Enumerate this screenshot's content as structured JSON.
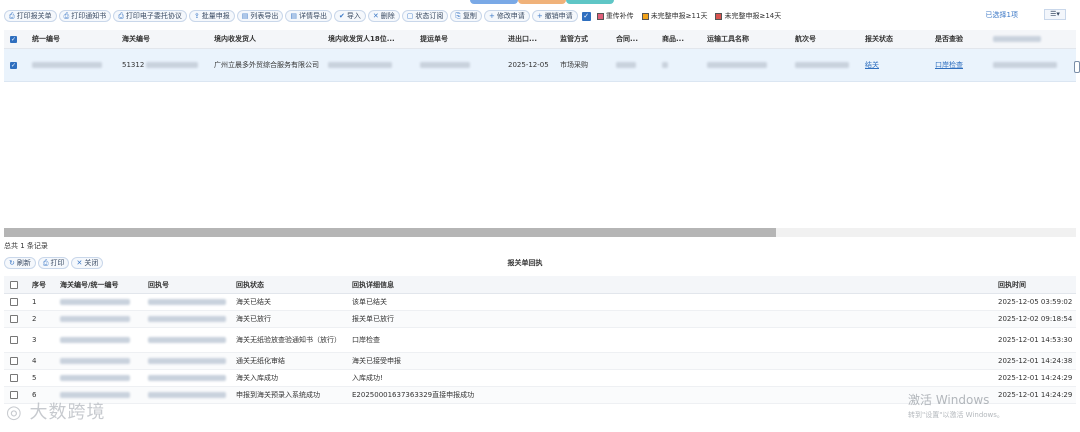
{
  "top_tabs": [
    {
      "color": "#7aa9e6"
    },
    {
      "color": "#f0b27a"
    },
    {
      "color": "#5fc6c6"
    }
  ],
  "toolbar": {
    "buttons": [
      {
        "icon": "print-icon",
        "glyph": "⎙",
        "label": "打印报关单"
      },
      {
        "icon": "print-icon",
        "glyph": "⎙",
        "label": "打印通知书"
      },
      {
        "icon": "print-icon",
        "glyph": "⎙",
        "label": "打印电子委托协议"
      },
      {
        "icon": "upload-icon",
        "glyph": "⇪",
        "label": "批量申报"
      },
      {
        "icon": "export-icon",
        "glyph": "▤",
        "label": "列表导出"
      },
      {
        "icon": "export-icon",
        "glyph": "▤",
        "label": "详情导出"
      },
      {
        "icon": "import-icon",
        "glyph": "✔",
        "label": "导入"
      },
      {
        "icon": "trash-icon",
        "glyph": "✕",
        "label": "删除"
      },
      {
        "icon": "status-icon",
        "glyph": "▢",
        "label": "状态订阅"
      },
      {
        "icon": "copy-icon",
        "glyph": "⎘",
        "label": "复制"
      },
      {
        "icon": "plus-icon",
        "glyph": "+",
        "label": "修改申请"
      },
      {
        "icon": "plus-icon",
        "glyph": "+",
        "label": "撤销申请"
      }
    ],
    "legend": [
      {
        "label": "重传补传",
        "color": "#e0607a"
      },
      {
        "label": "未完整申报≥11天",
        "color": "#f2a31b"
      },
      {
        "label": "未完整申报≥14天",
        "color": "#d9534f"
      }
    ],
    "selected_count": "已选择1项",
    "view_label": "☰▾"
  },
  "main_table": {
    "columns": [
      "统一编号",
      "海关编号",
      "境内收发货人",
      "境内收发货人18位...",
      "提运单号",
      "进出口...",
      "监管方式",
      "合同...",
      "商品...",
      "运输工具名称",
      "航次号",
      "报关状态",
      "是否查验",
      ""
    ],
    "row": {
      "customs_no": "51312",
      "consignee": "广州立晨多外贸综合服务有限公司",
      "date": "2025-12-05",
      "supervision": "市场采购",
      "status": "结关",
      "inspection": "口岸检查"
    }
  },
  "total_records": "总共 1 条记录",
  "sub_toolbar": {
    "refresh": "刷新",
    "print": "打印",
    "close": "关闭",
    "title": "报关单回执"
  },
  "receipt_table": {
    "columns": [
      "序号",
      "海关编号/统一编号",
      "回执号",
      "回执状态",
      "回执详细信息",
      "回执时间"
    ],
    "rows": [
      {
        "no": "1",
        "status": "海关已结关",
        "detail": "该单已结关",
        "time": "2025-12-05 03:59:02"
      },
      {
        "no": "2",
        "status": "海关已放行",
        "detail": "报关单已放行",
        "time": "2025-12-02 09:18:54"
      },
      {
        "no": "3",
        "status": "海关无纸验放查验通知书（放行）",
        "detail": "口岸检查",
        "time": "2025-12-01 14:53:30"
      },
      {
        "no": "4",
        "status": "通关无纸化审结",
        "detail": "海关已接受申报",
        "time": "2025-12-01 14:24:38"
      },
      {
        "no": "5",
        "status": "海关入库成功",
        "detail": "入库成功!",
        "time": "2025-12-01 14:24:29"
      },
      {
        "no": "6",
        "status": "申报到海关预录入系统成功",
        "detail": "E20250001637363329直接申报成功",
        "time": "2025-12-01 14:24:29"
      }
    ]
  },
  "watermark": "大数跨境",
  "windows_activation": {
    "line1": "激活 Windows",
    "line2": "转到\"设置\"以激活 Windows。"
  }
}
